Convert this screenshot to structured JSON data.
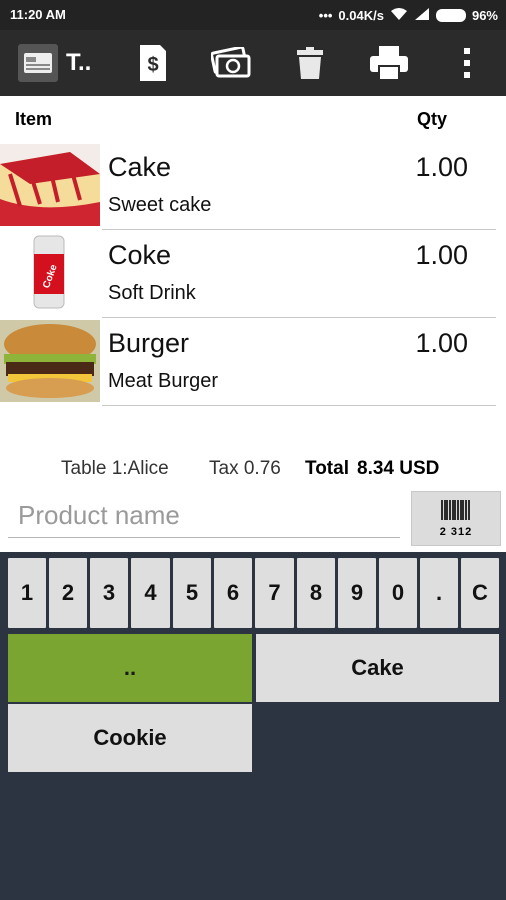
{
  "status": {
    "time": "11:20 AM",
    "network_speed": "0.04K/s",
    "battery": "96%"
  },
  "toolbar": {
    "tab_label": "T..",
    "icons": [
      "ticket-icon",
      "receipt-icon",
      "payment-icon",
      "delete-icon",
      "print-icon",
      "more-icon"
    ]
  },
  "list": {
    "header_item": "Item",
    "header_qty": "Qty",
    "items": [
      {
        "name": "Cake",
        "description": "Sweet cake",
        "qty": "1.00"
      },
      {
        "name": "Coke",
        "description": "Soft Drink",
        "qty": "1.00"
      },
      {
        "name": "Burger",
        "description": "Meat Burger",
        "qty": "1.00"
      }
    ]
  },
  "totals": {
    "table": "Table 1:Alice",
    "tax": "Tax 0.76",
    "total_label": "Total",
    "total_value": "8.34 USD"
  },
  "search": {
    "placeholder": "Product name",
    "barcode_number": "2 312"
  },
  "keypad": {
    "keys": [
      "1",
      "2",
      "3",
      "4",
      "5",
      "6",
      "7",
      "8",
      "9",
      "0",
      ".",
      "C"
    ]
  },
  "catalog": {
    "buttons": [
      {
        "label": "..",
        "color": "#7aa530"
      },
      {
        "label": "Cake",
        "color": "#dedede"
      },
      {
        "label": "Cookie",
        "color": "#dedede"
      }
    ]
  }
}
